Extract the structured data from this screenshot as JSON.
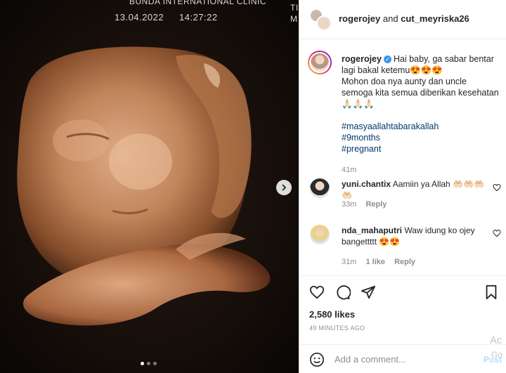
{
  "media": {
    "overlay": {
      "clinic": "BUNDA INTERNATIONAL CLINIC",
      "date": "13.04.2022",
      "time": "14:27:22",
      "edge_t": "TI",
      "edge_m": "M"
    },
    "carousel_dots": 3,
    "active_dot": 0
  },
  "header": {
    "user1": "rogerojey",
    "joiner": "and",
    "user2": "cut_meyriska26"
  },
  "caption": {
    "username": "rogerojey",
    "line1": "Hai baby, ga sabar bentar lagi bakal ketemu😍😍😍",
    "line2": "Mohon doa nya aunty dan uncle semoga kita semua diberikan kesehatan🙏🏻🙏🏻🙏🏻",
    "hashtags": [
      "#masyaallahtabarakallah",
      "#9months",
      "#pregnant"
    ],
    "time": "41m"
  },
  "comments": [
    {
      "username": "yuni.chantix",
      "text": "Aamiin ya Allah 🤲🏻🤲🏻🤲🏻🤲🏻",
      "time": "33m",
      "likes": "",
      "reply": "Reply"
    },
    {
      "username": "nda_mahaputri",
      "text": "Waw idung ko ojey bangettttt 😍😍",
      "time": "31m",
      "likes": "1 like",
      "reply": "Reply"
    }
  ],
  "stats": {
    "likes": "2,580 likes",
    "ago": "49 MINUTES AGO"
  },
  "add_comment": {
    "placeholder": "Add a comment...",
    "post": "Post"
  },
  "watermark": {
    "line1": "Ac",
    "line2": "Go"
  },
  "colors": {
    "link": "#00376b",
    "verified": "#3897f0",
    "muted": "#8e8e8e",
    "post_disabled": "#b2dffc"
  }
}
